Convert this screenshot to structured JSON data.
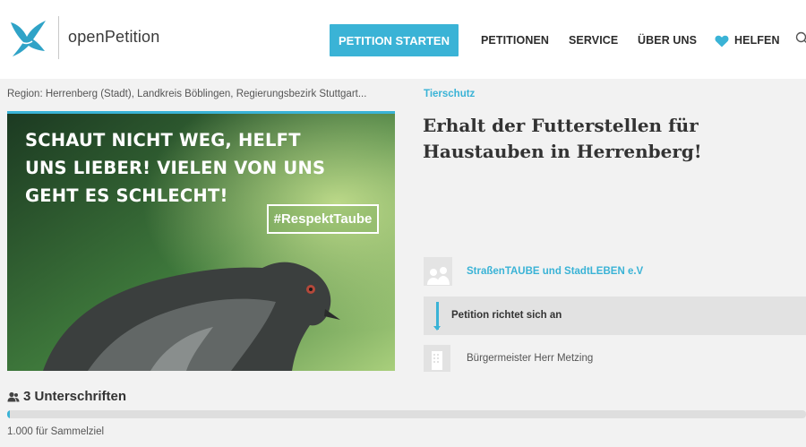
{
  "header": {
    "logo_text": "openPetition",
    "start_button": "PETITION STARTEN",
    "nav": {
      "petitions": "PETITIONEN",
      "service": "SERVICE",
      "about": "ÜBER UNS",
      "help": "HELFEN"
    },
    "accent_color": "#3ab3d6"
  },
  "petition": {
    "region": "Region: Herrenberg (Stadt), Landkreis Böblingen, Regierungsbezirk Stuttgart...",
    "category": "Tierschutz",
    "title": "Erhalt der Futterstellen für Haustauben in Herrenberg!",
    "image": {
      "text_line1": "SCHAUT NICHT WEG, HELFT",
      "text_line2": "UNS LIEBER! VIELEN VON UNS",
      "text_line3": "GEHT ES SCHLECHT!",
      "hashtag": "#RespektTaube"
    },
    "author": "StraßenTAUBE und StadtLEBEN e.V",
    "addressed_label": "Petition richtet sich an",
    "recipient": "Bürgermeister Herr Metzing"
  },
  "signatures": {
    "count_text": "3 Unterschriften",
    "goal_text": "1.000 für Sammelziel",
    "progress_fraction": 0.003
  }
}
